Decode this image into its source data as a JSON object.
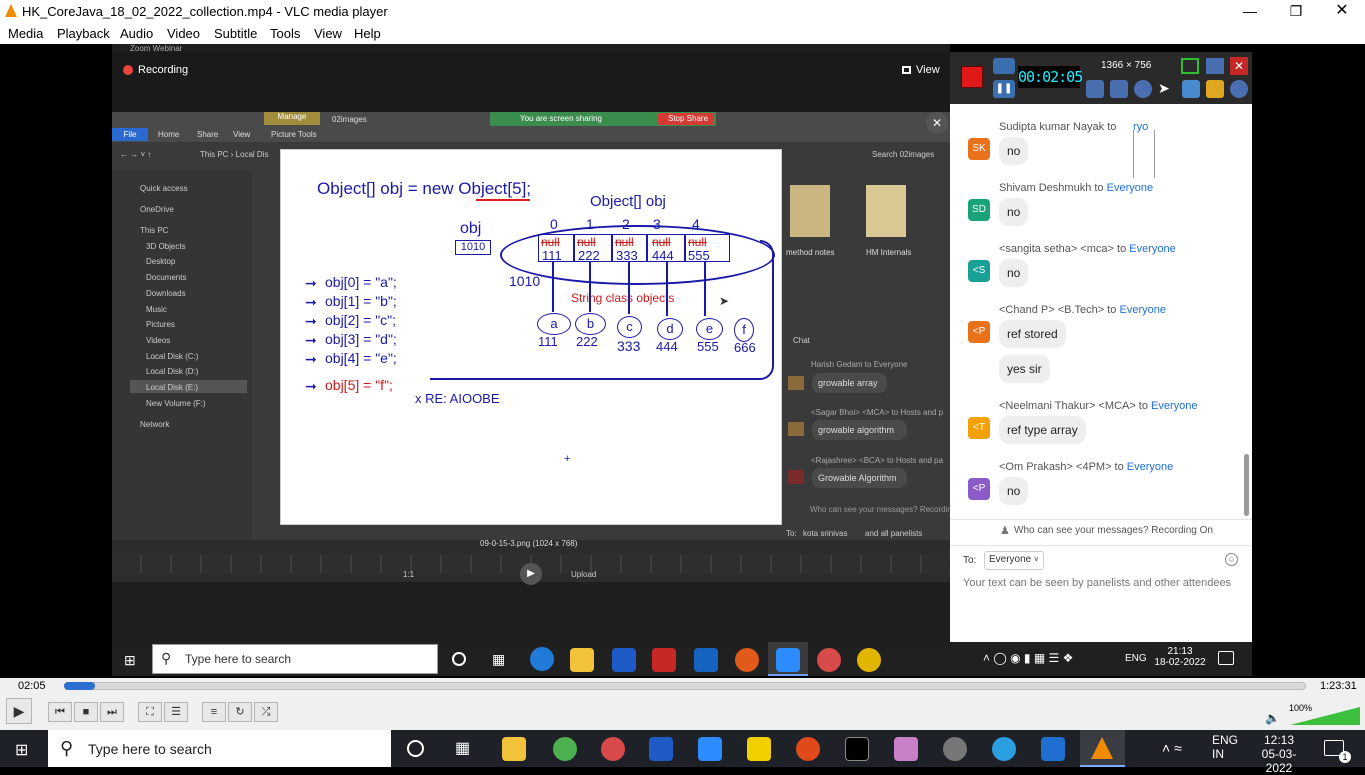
{
  "window": {
    "title": "HK_CoreJava_18_02_2022_collection.mp4 - VLC media player"
  },
  "menu": [
    "Media",
    "Playback",
    "Audio",
    "Video",
    "Subtitle",
    "Tools",
    "View",
    "Help"
  ],
  "zoom": {
    "recording_label": "Recording",
    "view_label": "View",
    "sharing_label": "You are screen sharing",
    "stop_share_label": "Stop Share",
    "webinar_label": "Zoom Webinar"
  },
  "explorer": {
    "ribbon": [
      "File",
      "Home",
      "Share",
      "View",
      "Picture Tools"
    ],
    "manage_label": "Manage",
    "folder_name": "02images",
    "path": "This PC › Local Dis",
    "search_placeholder": "Search 02images",
    "sidebar": [
      "Quick access",
      "OneDrive",
      "This PC",
      "3D Objects",
      "Desktop",
      "Documents",
      "Downloads",
      "Music",
      "Pictures",
      "Videos",
      "Local Disk (C:)",
      "Local Disk (D:)",
      "Local Disk (E:)",
      "New Volume (F:)",
      "Network"
    ],
    "folder_labels": [
      "method notes",
      "HM Internals"
    ],
    "image_caption": "09-0-15-3.png (1024 x 768)",
    "upload_label": "Upload",
    "zoom_label": "1:1"
  },
  "slide": {
    "heading": "Object[] obj = new Object[5];",
    "array_label": "Object[] obj",
    "var_label": "obj",
    "ref_value": "1010",
    "ref_value2": "1010",
    "indices": [
      "0",
      "1",
      "2",
      "3",
      "4"
    ],
    "cells_null": [
      "null",
      "null",
      "null",
      "null",
      "null"
    ],
    "cells_ref": [
      "111",
      "222",
      "333",
      "444",
      "555"
    ],
    "assignments": [
      "obj[0] = \"a\";",
      "obj[1] = \"b\";",
      "obj[2] = \"c\";",
      "obj[3] = \"d\";",
      "obj[4] = \"e\";"
    ],
    "bad_assignment": "obj[5] = \"f\";",
    "string_label": "String class objects",
    "objects": [
      {
        "letter": "a",
        "addr": "111"
      },
      {
        "letter": "b",
        "addr": "222"
      },
      {
        "letter": "c",
        "addr": "333"
      },
      {
        "letter": "d",
        "addr": "444"
      },
      {
        "letter": "e",
        "addr": "555"
      },
      {
        "letter": "f",
        "addr": "666"
      }
    ],
    "error_label": "x RE: AIOOBE"
  },
  "inner_chat": {
    "header": "Chat",
    "messages": [
      {
        "sender": "Harish Gedam to Everyone",
        "text": "growable array"
      },
      {
        "sender": "<Sagar Bhoi> <MCA> to Hosts and p",
        "text": "growable algorithm"
      },
      {
        "sender": "<Rajashree> <BCA> to Hosts and pa",
        "text": "Growable Algorithm"
      }
    ],
    "who_label": "Who can see your messages? Recordin",
    "to_label": "To:",
    "to_value": "kota srinivas",
    "to_extra": "and all panelists"
  },
  "inner_taskbar": {
    "search_placeholder": "Type here to search",
    "time": "21:13",
    "date": "18-02-2022",
    "lang": "ENG"
  },
  "recorder": {
    "timer": "00:02:05",
    "resolution": "1366 × 756"
  },
  "chat": {
    "partial_to": "ryo",
    "messages": [
      {
        "initials": "SK",
        "color": "#e8711a",
        "sender": "Sudipta kumar Nayak to",
        "to": "",
        "bubbles": [
          "no"
        ]
      },
      {
        "initials": "SD",
        "color": "#1aa37a",
        "sender": "Shivam Deshmukh to",
        "to": "Everyone",
        "bubbles": [
          "no"
        ]
      },
      {
        "initials": "<S",
        "color": "#17a093",
        "sender": "<sangita setha> <mca> to",
        "to": "Everyone",
        "bubbles": [
          "no"
        ]
      },
      {
        "initials": "<P",
        "color": "#e8711a",
        "sender": "<Chand P> <B.Tech> to",
        "to": "Everyone",
        "bubbles": [
          "ref stored",
          "yes sir"
        ]
      },
      {
        "initials": "<T",
        "color": "#f2a100",
        "sender": "<Neelmani Thakur> <MCA> to",
        "to": "Everyone",
        "bubbles": [
          "ref type array"
        ]
      },
      {
        "initials": "<P",
        "color": "#8b5cc7",
        "sender": "<Om Prakash> <4PM> to",
        "to": "Everyone",
        "bubbles": [
          "no"
        ]
      }
    ],
    "who_label": "Who can see your messages? Recording On",
    "to_label": "To:",
    "to_value": "Everyone",
    "input_placeholder": "Your text can be seen by panelists and other attendees"
  },
  "player": {
    "time_current": "02:05",
    "time_total": "1:23:31",
    "progress_fraction": 0.025,
    "volume": "100%"
  },
  "taskbar": {
    "search_placeholder": "Type here to search",
    "time": "12:13",
    "date": "05-03-2022",
    "lang": "ENG",
    "region": "IN",
    "notifications": "1"
  }
}
